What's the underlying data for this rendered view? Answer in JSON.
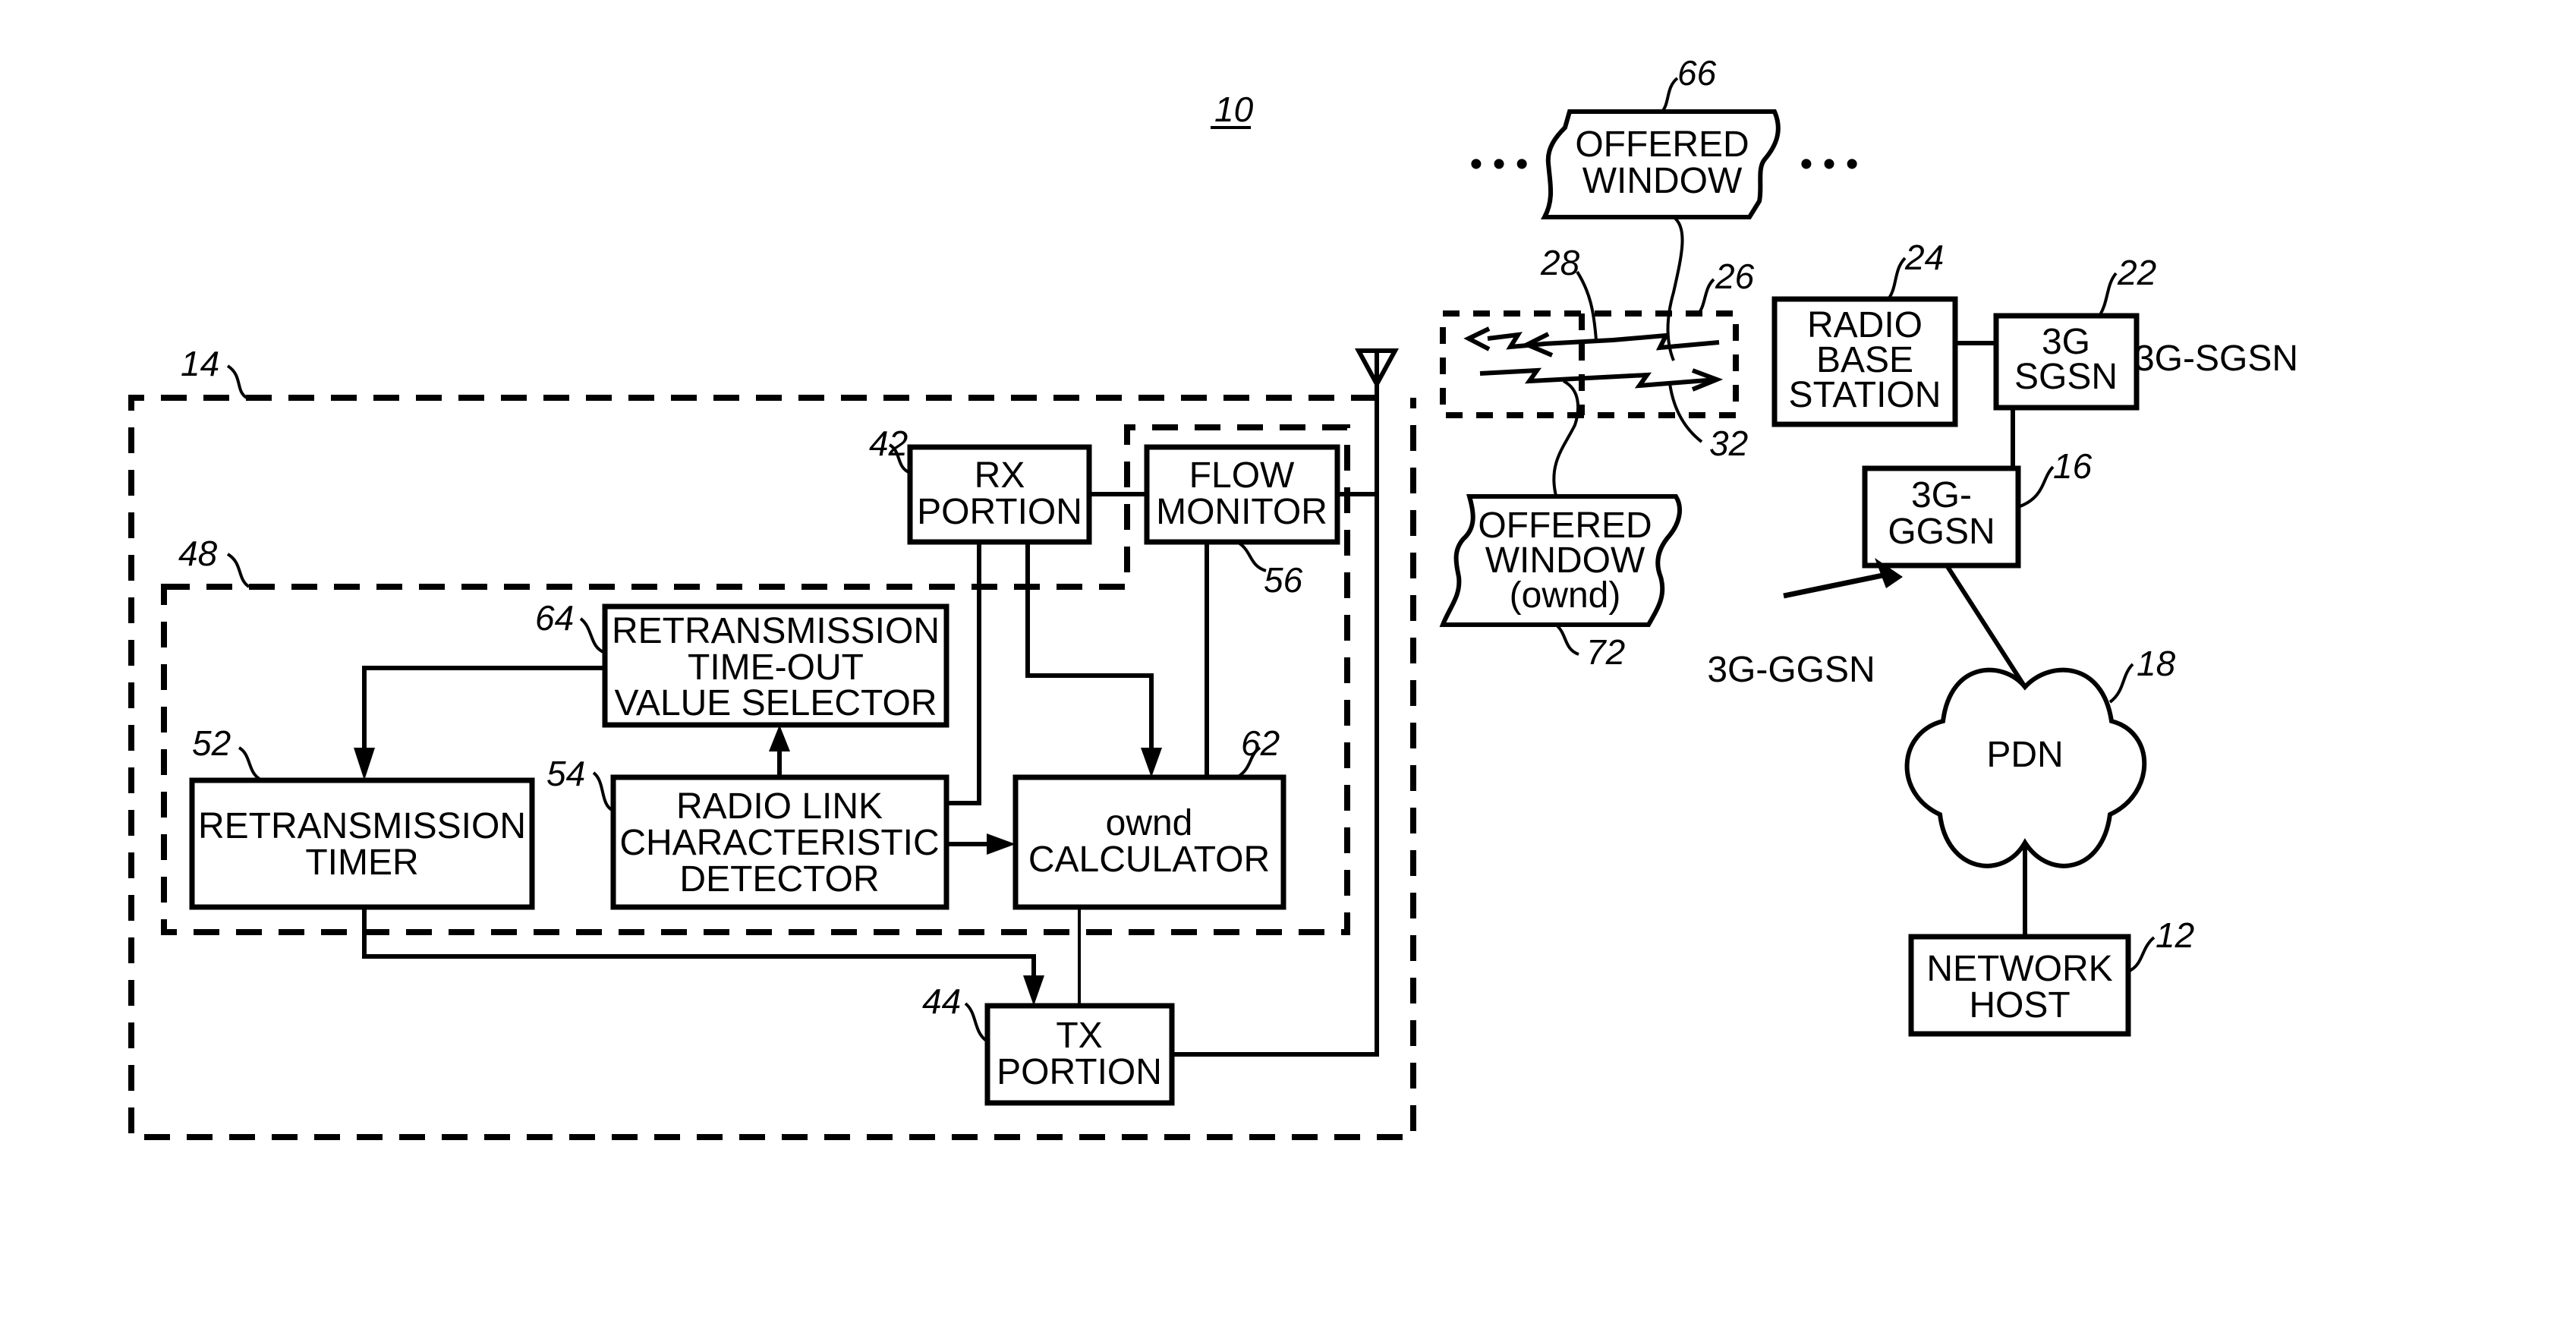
{
  "figure": {
    "reference": "10",
    "background": "#ffffff",
    "ink": "#000000"
  },
  "mobile_station": {
    "ref": "14",
    "subsystem_ref": "48",
    "blocks": {
      "rx_portion": {
        "ref": "42",
        "lines": [
          "RX",
          "PORTION"
        ]
      },
      "flow_monitor": {
        "ref": "56",
        "lines": [
          "FLOW",
          "MONITOR"
        ]
      },
      "retransmission_timeout_selector": {
        "ref": "64",
        "lines": [
          "RETRANSMISSION",
          "TIME-OUT",
          "VALUE SELECTOR"
        ]
      },
      "retransmission_timer": {
        "ref": "52",
        "lines": [
          "RETRANSMISSION",
          "TIMER"
        ]
      },
      "radio_link_detector": {
        "ref": "54",
        "lines": [
          "RADIO LINK",
          "CHARACTERISTIC",
          "DETECTOR"
        ]
      },
      "ownd_calculator": {
        "ref": "62",
        "lines": [
          "ownd",
          "CALCULATOR"
        ]
      },
      "tx_portion": {
        "ref": "44",
        "lines": [
          "TX",
          "PORTION"
        ]
      }
    }
  },
  "radio_link": {
    "ref": "26",
    "downlink_ref": "28",
    "uplink_ref": "32"
  },
  "offered_window_top": {
    "ref": "66",
    "lines": [
      "OFFERED",
      "WINDOW"
    ],
    "ellipsis": "• • •"
  },
  "offered_window_bottom": {
    "ref": "72",
    "lines": [
      "OFFERED",
      "WINDOW",
      "(ownd)"
    ]
  },
  "network": {
    "radio_base_station": {
      "ref": "24",
      "lines": [
        "RADIO",
        "BASE",
        "STATION"
      ]
    },
    "sgsn": {
      "ref": "22",
      "lines": [
        "3G",
        "SGSN"
      ],
      "side_label": "3G-SGSN"
    },
    "ggsn": {
      "ref": "16",
      "lines": [
        "3G-",
        "GGSN"
      ],
      "pointer_label": "3G-GGSN"
    },
    "pdn": {
      "ref": "18",
      "label": "PDN"
    },
    "network_host": {
      "ref": "12",
      "lines": [
        "NETWORK",
        "HOST"
      ]
    }
  }
}
